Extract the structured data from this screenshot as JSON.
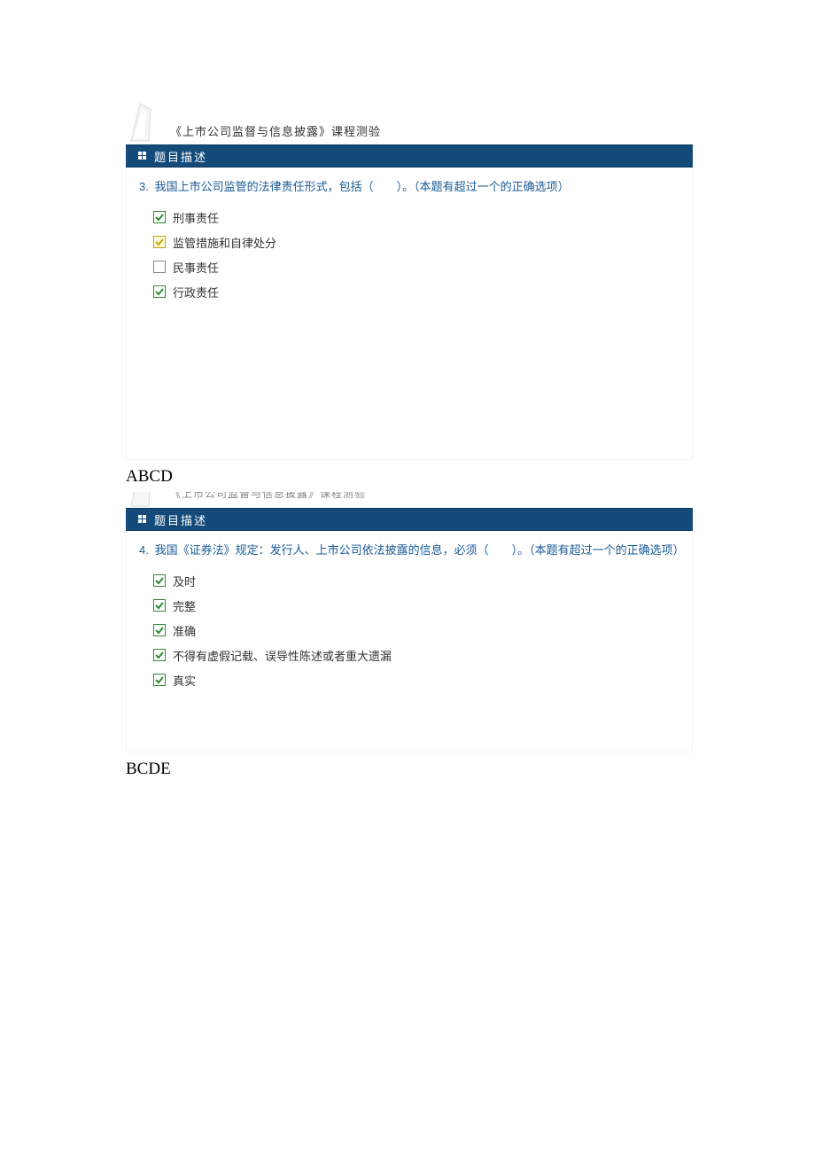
{
  "quiz_title": "《上市公司监督与信息披露》课程测验",
  "section_label": "题目描述",
  "questions": [
    {
      "number": "3.",
      "text": "我国上市公司监管的法律责任形式，包括（　　）。（本题有超过一个的正确选项）",
      "options": [
        {
          "label": "刑事责任",
          "state": "green"
        },
        {
          "label": "监管措施和自律处分",
          "state": "yellow"
        },
        {
          "label": "民事责任",
          "state": "empty"
        },
        {
          "label": "行政责任",
          "state": "green"
        }
      ],
      "answer": "ABCD"
    },
    {
      "number": "4.",
      "text": "我国《证券法》规定：发行人、上市公司依法披露的信息，必须（　　）。（本题有超过一个的正确选项）",
      "options": [
        {
          "label": "及时",
          "state": "green"
        },
        {
          "label": "完整",
          "state": "green"
        },
        {
          "label": "准确",
          "state": "green"
        },
        {
          "label": "不得有虚假记载、误导性陈述或者重大遗漏",
          "state": "green"
        },
        {
          "label": "真实",
          "state": "green"
        }
      ],
      "answer": "BCDE"
    }
  ]
}
